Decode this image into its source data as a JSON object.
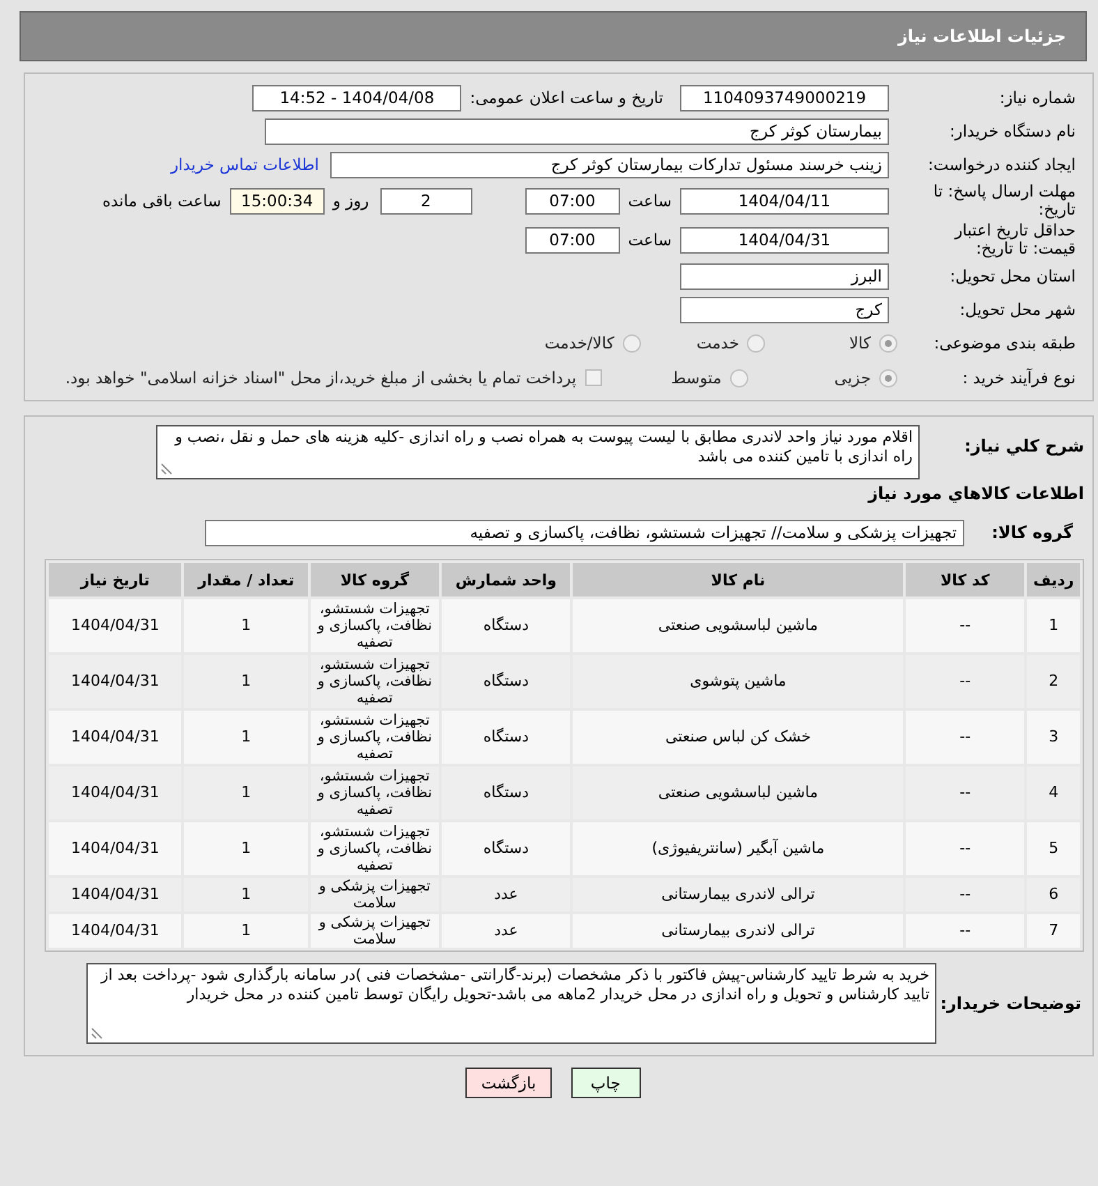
{
  "page_title": "جزئیات اطلاعات نیاز",
  "need_number": {
    "label": "شماره نیاز:",
    "value": "1104093749000219"
  },
  "announce": {
    "label": "تاریخ و ساعت اعلان عمومی:",
    "value": "1404/04/08 - 14:52"
  },
  "buyer_org": {
    "label": "نام دستگاه خریدار:",
    "value": "بیمارستان کوثر کرج"
  },
  "requester": {
    "label": "ایجاد کننده درخواست:",
    "value": "زینب خرسند مسئول تدارکات بیمارستان کوثر کرج",
    "link": "اطلاعات تماس خریدار"
  },
  "reply_deadline": {
    "label": "مهلت ارسال پاسخ: تا تاریخ:",
    "date": "1404/04/11",
    "time_label": "ساعت",
    "time": "07:00",
    "days": "2",
    "days_label": "روز و",
    "remaining": "15:00:34",
    "remaining_label": "ساعت باقی مانده"
  },
  "price_validity": {
    "label": "حداقل تاریخ اعتبار قیمت: تا تاریخ:",
    "date": "1404/04/31",
    "time_label": "ساعت",
    "time": "07:00"
  },
  "province": {
    "label": "استان محل تحویل:",
    "value": "البرز"
  },
  "city": {
    "label": "شهر محل تحویل:",
    "value": "کرج"
  },
  "category": {
    "label": "طبقه بندی موضوعی:",
    "options": [
      {
        "label": "کالا",
        "selected": true
      },
      {
        "label": "خدمت",
        "selected": false
      },
      {
        "label": "کالا/خدمت",
        "selected": false
      }
    ]
  },
  "process": {
    "label": "نوع فرآیند خرید :",
    "options": [
      {
        "label": "جزیی",
        "selected": true
      },
      {
        "label": "متوسط",
        "selected": false
      }
    ],
    "payment_option": {
      "label": "پرداخت تمام یا بخشی از مبلغ خرید،از محل \"اسناد خزانه اسلامی\" خواهد بود.",
      "checked": false
    }
  },
  "description": {
    "label": "شرح كلي نياز:",
    "value": "اقلام مورد نیاز واحد لاندری مطابق با لیست پیوست به همراه نصب و راه اندازی -کلیه هزینه های حمل و نقل ،نصب و راه اندازی با تامین کننده می باشد"
  },
  "items_heading": "اطلاعات كالاهاي مورد نياز",
  "goods_group": {
    "label": "گروه کالا:",
    "value": "تجهیزات پزشکی و سلامت// تجهیزات شستشو، نظافت، پاکسازی و تصفیه"
  },
  "table": {
    "columns": [
      "ردیف",
      "کد کالا",
      "نام کالا",
      "واحد شمارش",
      "گروه کالا",
      "تعداد / مقدار",
      "تاریخ نیاز"
    ],
    "rows": [
      [
        "1",
        "--",
        "ماشین لباسشویی صنعتی",
        "دستگاه",
        "تجهیزات شستشو، نظافت، پاکسازی و تصفیه",
        "1",
        "1404/04/31"
      ],
      [
        "2",
        "--",
        "ماشین پتوشوی",
        "دستگاه",
        "تجهیزات شستشو، نظافت، پاکسازی و تصفیه",
        "1",
        "1404/04/31"
      ],
      [
        "3",
        "--",
        "خشک کن لباس صنعتی",
        "دستگاه",
        "تجهیزات شستشو، نظافت، پاکسازی و تصفیه",
        "1",
        "1404/04/31"
      ],
      [
        "4",
        "--",
        "ماشین لباسشویی صنعتی",
        "دستگاه",
        "تجهیزات شستشو، نظافت، پاکسازی و تصفیه",
        "1",
        "1404/04/31"
      ],
      [
        "5",
        "--",
        "ماشین آبگیر (سانتریفیوژی)",
        "دستگاه",
        "تجهیزات شستشو، نظافت، پاکسازی و تصفیه",
        "1",
        "1404/04/31"
      ],
      [
        "6",
        "--",
        "ترالی لاندری بیمارستانی",
        "عدد",
        "تجهیزات پزشکی و سلامت",
        "1",
        "1404/04/31"
      ],
      [
        "7",
        "--",
        "ترالی لاندری بیمارستانی",
        "عدد",
        "تجهیزات پزشکی و سلامت",
        "1",
        "1404/04/31"
      ]
    ]
  },
  "buyer_notes": {
    "label": "توضیحات خریدار:",
    "value": "خرید به شرط تایید کارشناس-پیش فاکتور با ذکر مشخصات (برند-گارانتی -مشخصات فنی )در سامانه بارگذاری شود -پرداخت بعد از تایید کارشناس و تحویل و راه اندازی در محل خریدار 2ماهه می باشد-تحویل رایگان توسط تامین کننده در محل خریدار"
  },
  "buttons": [
    {
      "label": "چاپ",
      "kind": "print"
    },
    {
      "label": "بازگشت",
      "kind": "back"
    }
  ]
}
